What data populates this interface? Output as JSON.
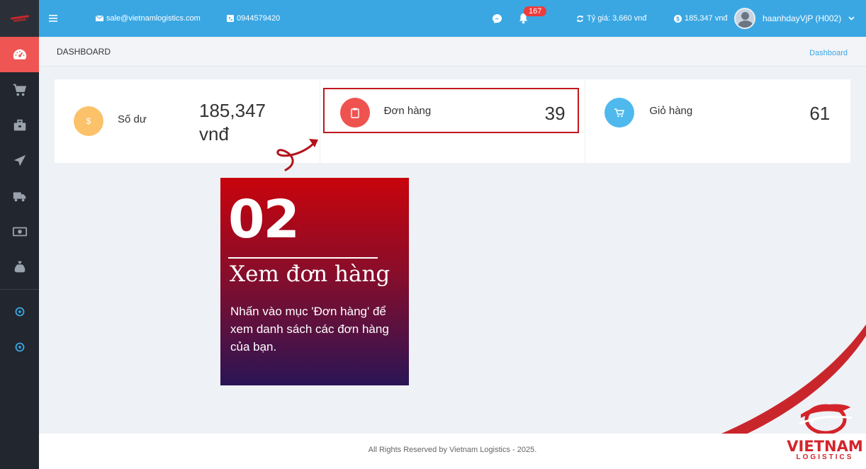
{
  "topbar": {
    "email": "sale@vietnamlogistics.com",
    "phone": "0944579420",
    "notification_count": "167",
    "exchange_rate": "Tỷ giá: 3,660 vnđ",
    "balance": "185,347 vnđ",
    "username": "haanhdayVjP (H002)"
  },
  "page": {
    "title": "DASHBOARD",
    "breadcrumb": "Dashboard"
  },
  "stats": [
    {
      "label": "Số dư",
      "value": "185,347 vnđ",
      "icon": "dollar-icon",
      "color": "#fbc26a"
    },
    {
      "label": "Đơn hàng",
      "value": "39",
      "icon": "clipboard-icon",
      "color": "#ef5350"
    },
    {
      "label": "Giỏ hàng",
      "value": "61",
      "icon": "cart-icon",
      "color": "#4fb9ee"
    }
  ],
  "callout": {
    "number": "02",
    "heading": "Xem đơn hàng",
    "description": "Nhấn vào mục 'Đơn hàng' để xem danh sách các đơn hàng của bạn."
  },
  "footer": {
    "copyright": "All Rights Reserved by Vietnam Logistics - 2025."
  },
  "brand": {
    "name": "VIETNAM",
    "sub": "LOGISTICS"
  },
  "sidebar": {
    "icons": [
      "dashboard-icon",
      "cart-icon",
      "briefcase-icon",
      "paper-plane-icon",
      "truck-icon",
      "money-icon",
      "money-bag-icon",
      "circle-dot-icon",
      "circle-dot-icon"
    ]
  },
  "colors": {
    "topbar": "#3aa7e3",
    "sidebar": "#22262e",
    "active": "#ee5553",
    "accent_red": "#c0171d"
  }
}
